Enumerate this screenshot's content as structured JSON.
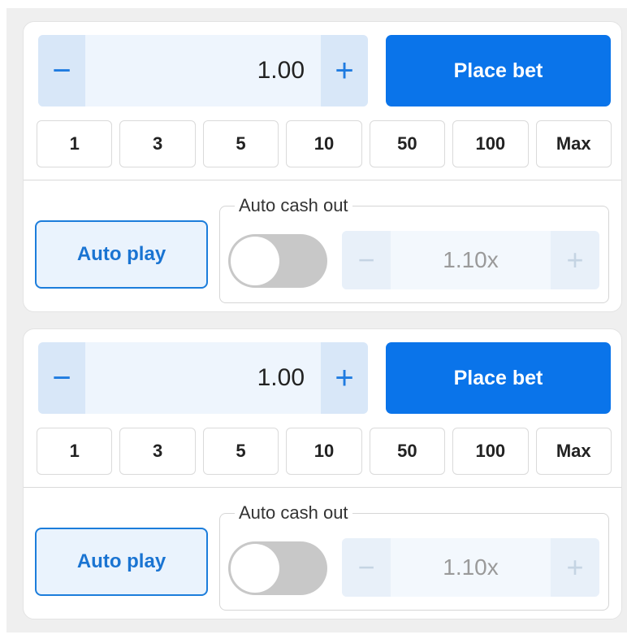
{
  "bet_panels": [
    {
      "amount": "1.00",
      "place_bet_label": "Place bet",
      "chips": [
        "1",
        "3",
        "5",
        "10",
        "50",
        "100",
        "Max"
      ],
      "auto_play_label": "Auto play",
      "auto_cash_out_label": "Auto cash out",
      "auto_cash_out_enabled": false,
      "multiplier": "1.10x"
    },
    {
      "amount": "1.00",
      "place_bet_label": "Place bet",
      "chips": [
        "1",
        "3",
        "5",
        "10",
        "50",
        "100",
        "Max"
      ],
      "auto_play_label": "Auto play",
      "auto_cash_out_label": "Auto cash out",
      "auto_cash_out_enabled": false,
      "multiplier": "1.10x"
    }
  ],
  "icons": {
    "minus": "minus-icon",
    "plus": "plus-icon"
  },
  "colors": {
    "accent": "#0a74ea",
    "step_bg": "#d8e7f8",
    "toggle_off": "#c8c8c8"
  }
}
